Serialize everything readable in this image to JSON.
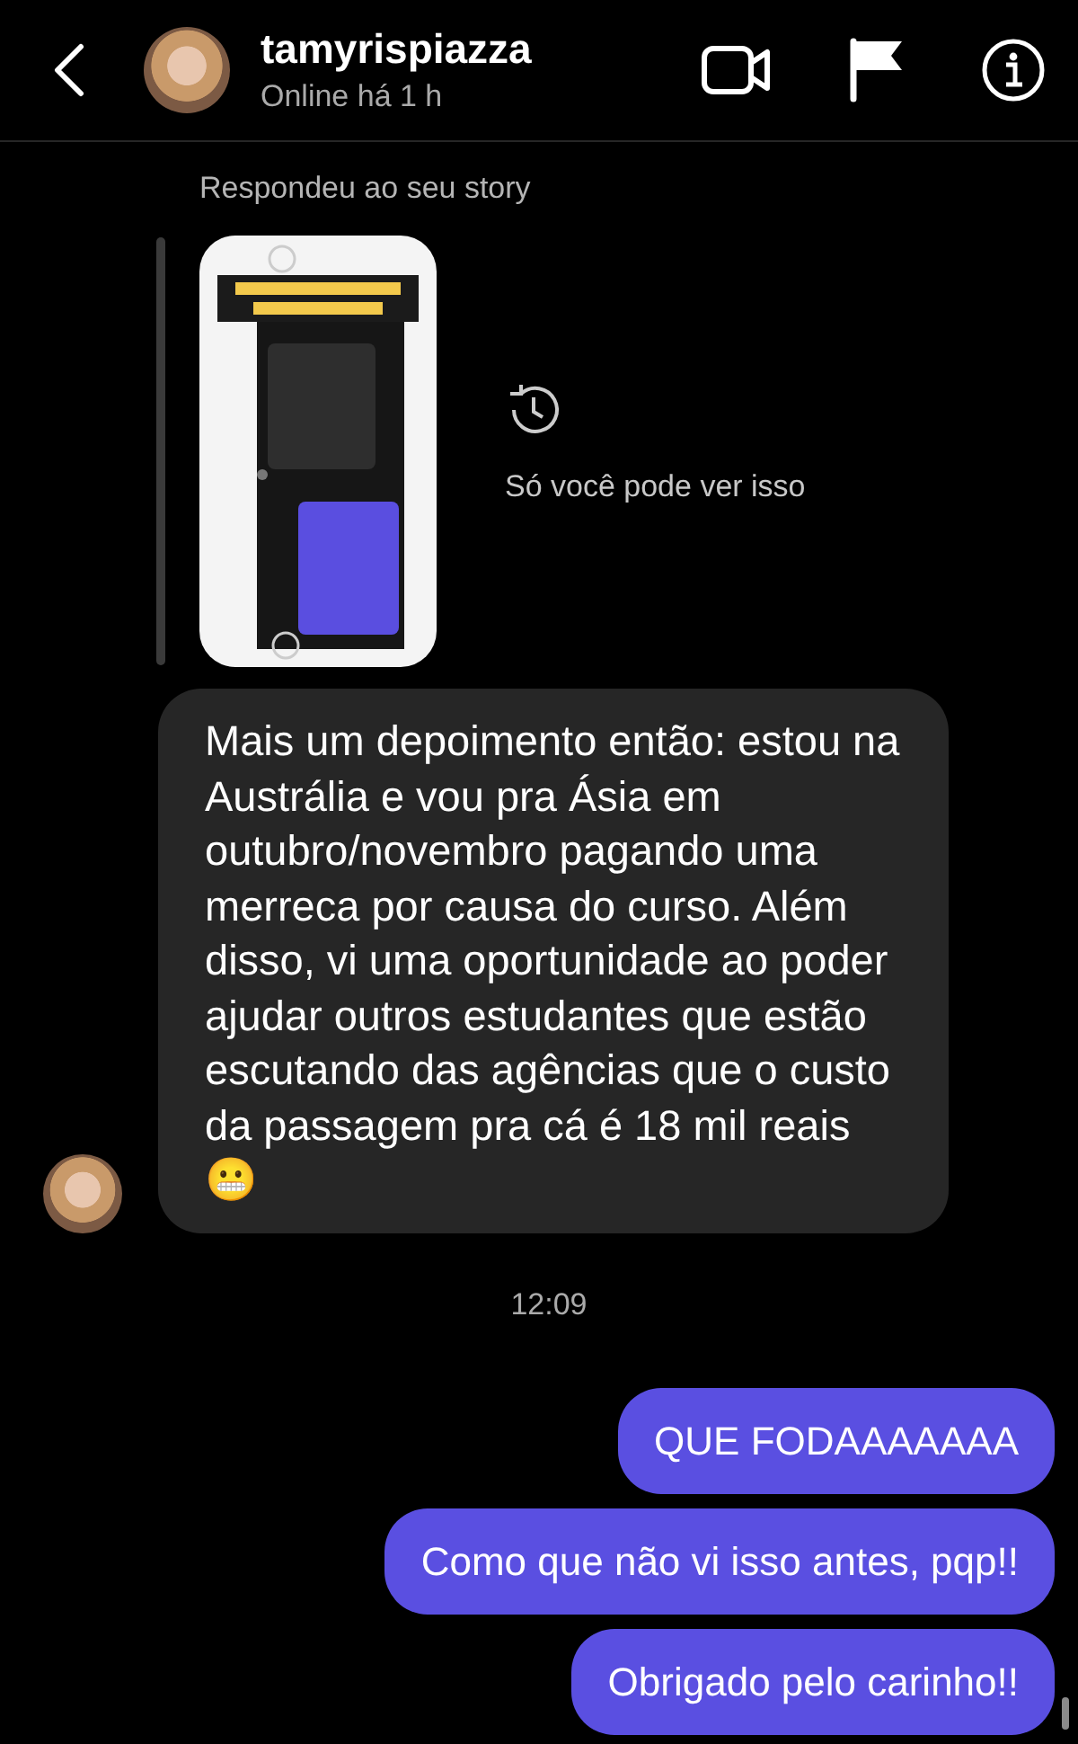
{
  "header": {
    "username": "tamyrispiazza",
    "status": "Online há 1 h"
  },
  "story_reply": {
    "label": "Respondeu ao seu story",
    "note": "Só você pode ver isso"
  },
  "messages": [
    {
      "kind": "incoming",
      "text": "Mais um depoimento então: estou na Austrália e vou pra Ásia em outubro/novembro pagando uma merreca por causa do curso. Além disso, vi uma oportunidade ao poder ajudar outros estudantes que estão escutando das agências que o custo da passagem pra cá é 18 mil reais 😬"
    },
    {
      "kind": "time",
      "text": "12:09"
    },
    {
      "kind": "outgoing",
      "text": "QUE FODAAAAAAA"
    },
    {
      "kind": "outgoing",
      "text": "Como que não vi isso antes, pqp!!"
    },
    {
      "kind": "outgoing",
      "text": "Obrigado pelo carinho!!"
    }
  ]
}
